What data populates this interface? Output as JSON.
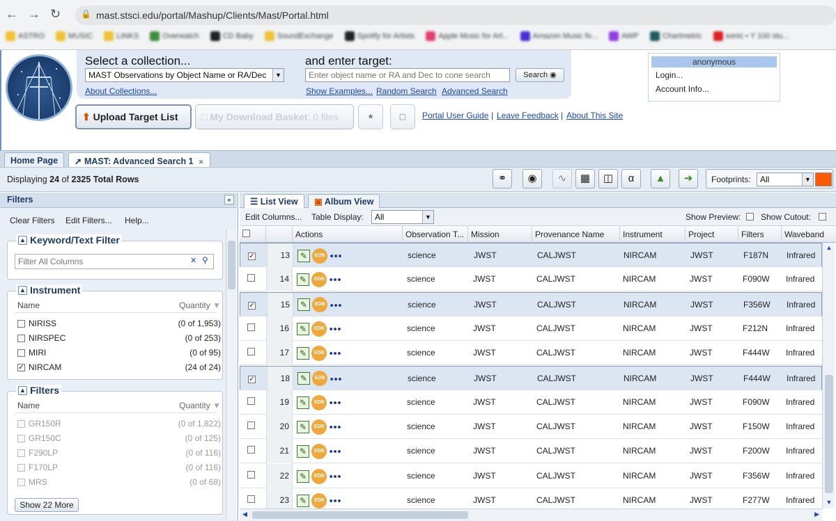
{
  "browser": {
    "url": "mast.stsci.edu/portal/Mashup/Clients/Mast/Portal.html",
    "bookmarks": [
      {
        "label": "ASTRO",
        "color": "#f1c233"
      },
      {
        "label": "MUSIC",
        "color": "#f1c233"
      },
      {
        "label": "LINKS",
        "color": "#f1c233"
      },
      {
        "label": "Overwatch",
        "color": "#3d8f3d"
      },
      {
        "label": "CD Baby",
        "color": "#222222"
      },
      {
        "label": "SoundExchange",
        "color": "#f1c233"
      },
      {
        "label": "Spotify for Artists",
        "color": "#222222"
      },
      {
        "label": "Apple Music for Art...",
        "color": "#e33f6e"
      },
      {
        "label": "Amazon Music fo...",
        "color": "#4b2fd6"
      },
      {
        "label": "AWP",
        "color": "#9040e0"
      },
      {
        "label": "Chartmetric",
        "color": "#1f5c5c"
      },
      {
        "label": "sonic • Y 100 stu...",
        "color": "#e02020"
      }
    ]
  },
  "header": {
    "select_collection_title": "Select a collection...",
    "collection_value": "MAST Observations by Object Name or RA/Dec",
    "about_collections": "About Collections...",
    "enter_target_title": "and enter target:",
    "target_placeholder": "Enter object name or RA and Dec to cone search",
    "search_label": "Search",
    "show_examples": "Show Examples...",
    "random_search": "Random Search",
    "advanced_search": "Advanced Search",
    "upload_target_list": "Upload Target List",
    "download_basket": "My Download Basket",
    "download_files": ": 0 files",
    "portal_user_guide": "Portal User Guide",
    "leave_feedback": "Leave Feedback",
    "about_site": "About This Site",
    "sep": "|"
  },
  "user": {
    "name": "anonymous",
    "login": "Login...",
    "account": "Account Info..."
  },
  "tabs": {
    "home": "Home Page",
    "search": "MAST: Advanced Search 1"
  },
  "toolbar": {
    "displaying_prefix": "Displaying",
    "shown": "24",
    "of_word": "of",
    "total": "2325 Total Rows",
    "footprints_label": "Footprints:",
    "footprints_value": "All",
    "footprint_color": "#ff5a00"
  },
  "filters": {
    "title": "Filters",
    "clear": "Clear Filters",
    "edit": "Edit Filters...",
    "help": "Help...",
    "keyword_title": "Keyword/Text Filter",
    "keyword_placeholder": "Filter All Columns",
    "instrument_title": "Instrument",
    "col_name": "Name",
    "col_quantity": "Quantity",
    "instruments": [
      {
        "name": "NIRISS",
        "qty": "(0 of 1,953)",
        "checked": false
      },
      {
        "name": "NIRSPEC",
        "qty": "(0 of 253)",
        "checked": false
      },
      {
        "name": "MIRI",
        "qty": "(0 of 95)",
        "checked": false
      },
      {
        "name": "NIRCAM",
        "qty": "(24 of 24)",
        "checked": true
      }
    ],
    "filters_title": "Filters",
    "filter_items": [
      {
        "name": "GR150R",
        "qty": "(0 of 1,822)"
      },
      {
        "name": "GR150C",
        "qty": "(0 of 125)"
      },
      {
        "name": "F290LP",
        "qty": "(0 of 116)"
      },
      {
        "name": "F170LP",
        "qty": "(0 of 116)"
      },
      {
        "name": "MRS",
        "qty": "(0 of 68)"
      }
    ],
    "show_more": "Show 22 More"
  },
  "grid": {
    "list_view": "List View",
    "album_view": "Album View",
    "edit_columns": "Edit Columns...",
    "table_display": "Table Display:",
    "table_display_value": "All",
    "show_preview": "Show Preview:",
    "show_cutout": "Show Cutout:",
    "columns": {
      "actions": "Actions",
      "obs_type": "Observation T...",
      "mission": "Mission",
      "provenance": "Provenance Name",
      "instrument": "Instrument",
      "project": "Project",
      "filters": "Filters",
      "waveband": "Waveband"
    },
    "edb": "EDB",
    "dots": "•••",
    "rows": [
      {
        "n": "13",
        "checked": true,
        "type": "science",
        "mission": "JWST",
        "prov": "CALJWST",
        "inst": "NIRCAM",
        "proj": "JWST",
        "filter": "F187N",
        "band": "Infrared"
      },
      {
        "n": "14",
        "checked": false,
        "type": "science",
        "mission": "JWST",
        "prov": "CALJWST",
        "inst": "NIRCAM",
        "proj": "JWST",
        "filter": "F090W",
        "band": "Infrared"
      },
      {
        "n": "15",
        "checked": true,
        "type": "science",
        "mission": "JWST",
        "prov": "CALJWST",
        "inst": "NIRCAM",
        "proj": "JWST",
        "filter": "F356W",
        "band": "Infrared"
      },
      {
        "n": "16",
        "checked": false,
        "type": "science",
        "mission": "JWST",
        "prov": "CALJWST",
        "inst": "NIRCAM",
        "proj": "JWST",
        "filter": "F212N",
        "band": "Infrared"
      },
      {
        "n": "17",
        "checked": false,
        "type": "science",
        "mission": "JWST",
        "prov": "CALJWST",
        "inst": "NIRCAM",
        "proj": "JWST",
        "filter": "F444W",
        "band": "Infrared"
      },
      {
        "n": "18",
        "checked": true,
        "type": "science",
        "mission": "JWST",
        "prov": "CALJWST",
        "inst": "NIRCAM",
        "proj": "JWST",
        "filter": "F444W",
        "band": "Infrared"
      },
      {
        "n": "19",
        "checked": false,
        "type": "science",
        "mission": "JWST",
        "prov": "CALJWST",
        "inst": "NIRCAM",
        "proj": "JWST",
        "filter": "F090W",
        "band": "Infrared"
      },
      {
        "n": "20",
        "checked": false,
        "type": "science",
        "mission": "JWST",
        "prov": "CALJWST",
        "inst": "NIRCAM",
        "proj": "JWST",
        "filter": "F150W",
        "band": "Infrared"
      },
      {
        "n": "21",
        "checked": false,
        "type": "science",
        "mission": "JWST",
        "prov": "CALJWST",
        "inst": "NIRCAM",
        "proj": "JWST",
        "filter": "F200W",
        "band": "Infrared"
      },
      {
        "n": "22",
        "checked": false,
        "type": "science",
        "mission": "JWST",
        "prov": "CALJWST",
        "inst": "NIRCAM",
        "proj": "JWST",
        "filter": "F356W",
        "band": "Infrared"
      },
      {
        "n": "23",
        "checked": false,
        "type": "science",
        "mission": "JWST",
        "prov": "CALJWST",
        "inst": "NIRCAM",
        "proj": "JWST",
        "filter": "F277W",
        "band": "Infrared"
      }
    ]
  }
}
